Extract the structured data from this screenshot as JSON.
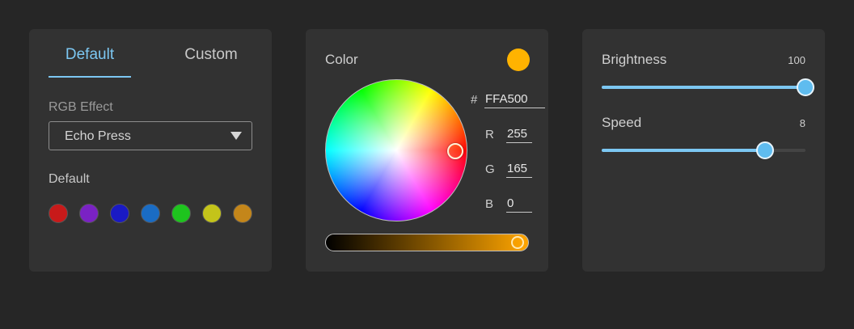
{
  "effect_panel": {
    "tabs": [
      {
        "label": "Default",
        "active": true
      },
      {
        "label": "Custom",
        "active": false
      }
    ],
    "rgb_effect_label": "RGB Effect",
    "rgb_effect_value": "Echo Press",
    "default_label": "Default",
    "swatches": [
      "#c81a1a",
      "#7a22c4",
      "#1a1ac4",
      "#1a6cc4",
      "#1ec41e",
      "#c4c41a",
      "#c4861a"
    ]
  },
  "color_panel": {
    "title": "Color",
    "preview_color": "#ffb300",
    "hex_symbol": "#",
    "hex": "FFA500",
    "r_label": "R",
    "r": "255",
    "g_label": "G",
    "g": "165",
    "b_label": "B",
    "b": "0"
  },
  "slider_panel": {
    "brightness": {
      "label": "Brightness",
      "value": "100",
      "min": 0,
      "max": 100,
      "level": 100
    },
    "speed": {
      "label": "Speed",
      "value": "8",
      "min": 0,
      "max": 10,
      "level": 8
    },
    "accent_color": "#7cc7f2"
  }
}
